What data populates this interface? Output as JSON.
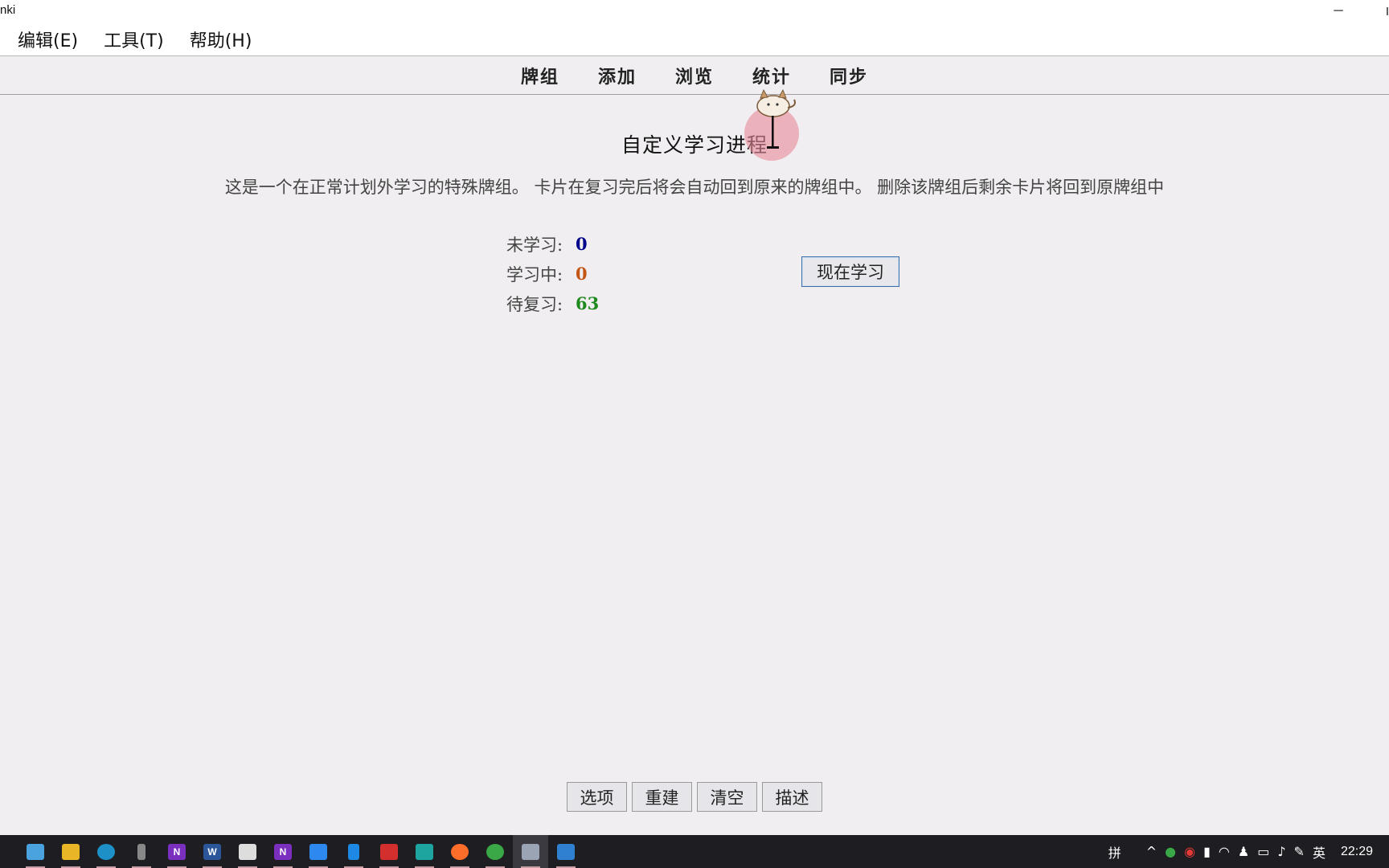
{
  "window": {
    "title": "nki",
    "minimize_glyph": "─"
  },
  "menu": [
    {
      "label": "编辑(E)"
    },
    {
      "label": "工具(T)"
    },
    {
      "label": "帮助(H)"
    }
  ],
  "toolbar": [
    {
      "label": "牌组"
    },
    {
      "label": "添加"
    },
    {
      "label": "浏览"
    },
    {
      "label": "统计"
    },
    {
      "label": "同步"
    }
  ],
  "page": {
    "title": "自定义学习进程",
    "description": "这是一个在正常计划外学习的特殊牌组。 卡片在复习完后将会自动回到原来的牌组中。 删除该牌组后剩余卡片将回到原牌组中"
  },
  "stats": {
    "new_label": "未学习:",
    "new_value": "0",
    "learning_label": "学习中:",
    "learning_value": "0",
    "review_label": "待复习:",
    "review_value": "63",
    "colors": {
      "new": "#00008b",
      "learning": "#c35617",
      "review": "#1e8a1e"
    }
  },
  "study_now_button": "现在学习",
  "bottom_buttons": [
    {
      "label": "选项"
    },
    {
      "label": "重建"
    },
    {
      "label": "清空"
    },
    {
      "label": "描述"
    }
  ],
  "taskbar": {
    "apps": [
      {
        "icon": "notepad-icon",
        "color": "#4aa3df",
        "text": ""
      },
      {
        "icon": "file-explorer-icon",
        "color": "#e8b526",
        "text": ""
      },
      {
        "icon": "edge-icon",
        "color": "#1e90c8",
        "text": ""
      },
      {
        "icon": "usb-drive-icon",
        "color": "#888888",
        "text": ""
      },
      {
        "icon": "onenote-icon",
        "color": "#7b2fbe",
        "text": "N"
      },
      {
        "icon": "word-icon",
        "color": "#2b579a",
        "text": "W"
      },
      {
        "icon": "screenshot-tool-icon",
        "color": "#dddddd",
        "text": ""
      },
      {
        "icon": "onenote-2-icon",
        "color": "#7b2fbe",
        "text": "N"
      },
      {
        "icon": "app-window-icon",
        "color": "#2d89ef",
        "text": ""
      },
      {
        "icon": "phone-link-icon",
        "color": "#1e88e5",
        "text": ""
      },
      {
        "icon": "acrobat-icon",
        "color": "#d32f2f",
        "text": ""
      },
      {
        "icon": "store-app-icon",
        "color": "#1fa5a0",
        "text": ""
      },
      {
        "icon": "firefox-icon",
        "color": "#ff6d2a",
        "text": ""
      },
      {
        "icon": "green-app-icon",
        "color": "#3aa847",
        "text": ""
      },
      {
        "icon": "anki-icon",
        "color": "#9aa4b4",
        "text": ""
      },
      {
        "icon": "photos-icon",
        "color": "#2f80d0",
        "text": ""
      }
    ],
    "ime_label": "拼",
    "lang_label": "英",
    "time": "22:29"
  }
}
